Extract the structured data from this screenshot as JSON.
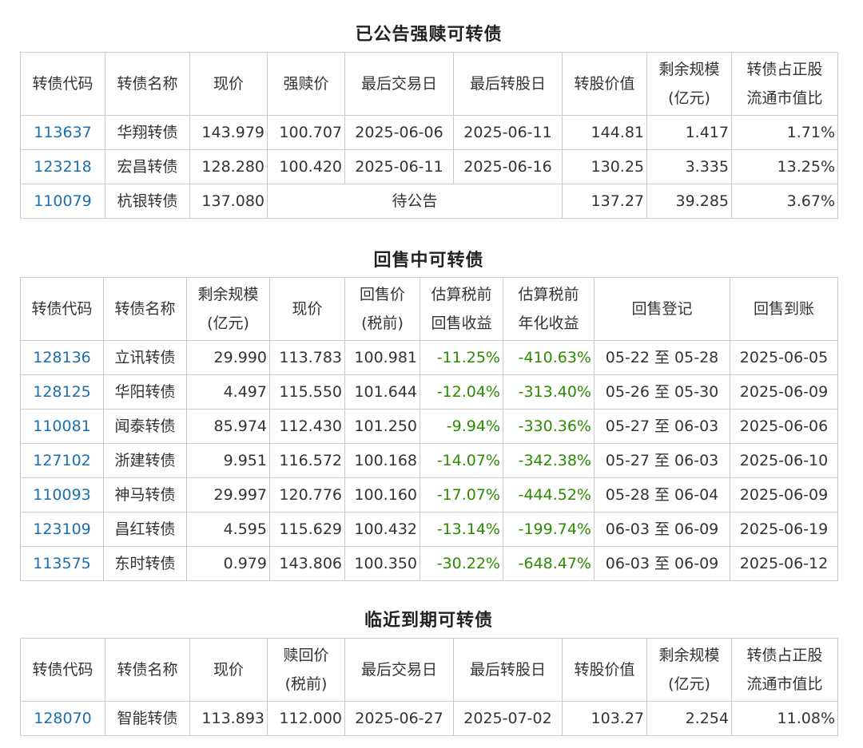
{
  "sections": {
    "redeem": {
      "title": "已公告强赎可转债",
      "headers": [
        "转债代码",
        "转债名称",
        "现价",
        "强赎价",
        "最后交易日",
        "最后转股日",
        "转股价值",
        "剩余规模",
        "(亿元)",
        "转债占正股",
        "流通市值比"
      ],
      "rows": [
        {
          "code": "113637",
          "name": "华翔转债",
          "price": "143.979",
          "redeem_price": "100.707",
          "last_trade": "2025-06-06",
          "last_convert": "2025-06-11",
          "conv_value": "144.81",
          "remaining": "1.417",
          "ratio": "1.71%"
        },
        {
          "code": "123218",
          "name": "宏昌转债",
          "price": "128.280",
          "redeem_price": "100.420",
          "last_trade": "2025-06-11",
          "last_convert": "2025-06-16",
          "conv_value": "130.25",
          "remaining": "3.335",
          "ratio": "13.25%"
        },
        {
          "code": "110079",
          "name": "杭银转债",
          "price": "137.080",
          "pending": "待公告",
          "conv_value": "137.27",
          "remaining": "39.285",
          "ratio": "3.67%"
        }
      ]
    },
    "putback": {
      "title": "回售中可转债",
      "headers": [
        "转债代码",
        "转债名称",
        "剩余规模",
        "(亿元)",
        "现价",
        "回售价",
        "(税前)",
        "估算税前",
        "回售收益",
        "估算税前",
        "年化收益",
        "回售登记",
        "回售到账"
      ],
      "rows": [
        {
          "code": "128136",
          "name": "立讯转债",
          "remaining": "29.990",
          "price": "113.783",
          "put_price": "100.981",
          "yield": "-11.25%",
          "annual": "-410.63%",
          "register": "05-22 至 05-28",
          "paid": "2025-06-05"
        },
        {
          "code": "128125",
          "name": "华阳转债",
          "remaining": "4.497",
          "price": "115.550",
          "put_price": "101.644",
          "yield": "-12.04%",
          "annual": "-313.40%",
          "register": "05-26 至 05-30",
          "paid": "2025-06-09"
        },
        {
          "code": "110081",
          "name": "闻泰转债",
          "remaining": "85.974",
          "price": "112.430",
          "put_price": "101.250",
          "yield": "-9.94%",
          "annual": "-330.36%",
          "register": "05-27 至 06-03",
          "paid": "2025-06-06"
        },
        {
          "code": "127102",
          "name": "浙建转债",
          "remaining": "9.951",
          "price": "116.572",
          "put_price": "100.168",
          "yield": "-14.07%",
          "annual": "-342.38%",
          "register": "05-27 至 06-03",
          "paid": "2025-06-10"
        },
        {
          "code": "110093",
          "name": "神马转债",
          "remaining": "29.997",
          "price": "120.776",
          "put_price": "100.160",
          "yield": "-17.07%",
          "annual": "-444.52%",
          "register": "05-28 至 06-04",
          "paid": "2025-06-09"
        },
        {
          "code": "123109",
          "name": "昌红转债",
          "remaining": "4.595",
          "price": "115.629",
          "put_price": "100.432",
          "yield": "-13.14%",
          "annual": "-199.74%",
          "register": "06-03 至 06-09",
          "paid": "2025-06-19"
        },
        {
          "code": "113575",
          "name": "东时转债",
          "remaining": "0.979",
          "price": "143.806",
          "put_price": "100.350",
          "yield": "-30.22%",
          "annual": "-648.47%",
          "register": "06-03 至 06-09",
          "paid": "2025-06-12"
        }
      ]
    },
    "maturity": {
      "title": "临近到期可转债",
      "headers": [
        "转债代码",
        "转债名称",
        "现价",
        "赎回价",
        "(税前)",
        "最后交易日",
        "最后转股日",
        "转股价值",
        "剩余规模",
        "(亿元)",
        "转债占正股",
        "流通市值比"
      ],
      "rows": [
        {
          "code": "128070",
          "name": "智能转债",
          "price": "113.893",
          "redeem_price": "112.000",
          "last_trade": "2025-06-27",
          "last_convert": "2025-07-02",
          "conv_value": "103.27",
          "remaining": "2.254",
          "ratio": "11.08%"
        }
      ]
    }
  },
  "colors": {
    "code_link": "#1a6fb0",
    "negative_yield": "#2a8a00",
    "border": "#cccccc"
  }
}
